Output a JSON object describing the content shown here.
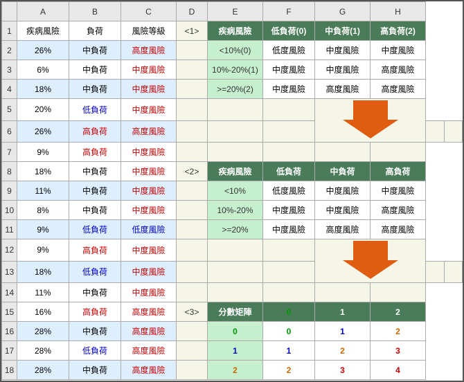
{
  "cols": {
    "rowHeader": "",
    "a": "A",
    "b": "B",
    "c": "C",
    "d": "D",
    "e": "E",
    "f": "F",
    "g": "G",
    "h": "H"
  },
  "rows": [
    {
      "rh": "1",
      "a": "疾病風險",
      "aClass": "",
      "b": "負荷",
      "bClass": "",
      "c": "風險等級",
      "cClass": "",
      "d": "<1>",
      "dClass": "d-label",
      "e": "疾病風險",
      "eClass": "tbl-header-dark",
      "f": "低負荷(0)",
      "fClass": "tbl-header-dark",
      "g": "中負荷(1)",
      "gClass": "tbl-header-dark",
      "h": "高負荷(2)",
      "hClass": "tbl-header-dark"
    },
    {
      "rh": "2",
      "a": "26%",
      "aClass": "",
      "b": "中負荷",
      "bClass": "",
      "c": "高度風險",
      "cClass": "red",
      "d": "",
      "dClass": "empty",
      "e": "<10%(0)",
      "eClass": "tbl-header-green",
      "f": "低度風險",
      "fClass": "bg-white",
      "g": "中度風險",
      "gClass": "bg-white",
      "h": "中度風險",
      "hClass": "bg-white"
    },
    {
      "rh": "3",
      "a": "6%",
      "aClass": "",
      "b": "中負荷",
      "bClass": "",
      "c": "中度風險",
      "cClass": "red",
      "d": "",
      "dClass": "empty",
      "e": "10%-20%(1)",
      "eClass": "tbl-header-green",
      "f": "中度風險",
      "fClass": "bg-white",
      "g": "中度風險",
      "gClass": "bg-white",
      "h": "高度風險",
      "hClass": "bg-white"
    },
    {
      "rh": "4",
      "a": "18%",
      "aClass": "",
      "b": "中負荷",
      "bClass": "",
      "c": "中度風險",
      "cClass": "red",
      "d": "",
      "dClass": "empty",
      "e": ">=20%(2)",
      "eClass": "tbl-header-green",
      "f": "中度風險",
      "fClass": "bg-white",
      "g": "高度風險",
      "gClass": "bg-white",
      "h": "高度風險",
      "hClass": "bg-white"
    },
    {
      "rh": "5",
      "a": "20%",
      "aClass": "",
      "b": "低負荷",
      "bClass": "blue",
      "c": "中度風險",
      "cClass": "red",
      "d": "",
      "dClass": "empty",
      "e": "",
      "eClass": "empty arrow-row",
      "f": "",
      "fClass": "empty arrow-row",
      "g": "arrow1",
      "gClass": "empty arrow-row",
      "h": "",
      "hClass": "empty arrow-row"
    },
    {
      "rh": "6",
      "a": "26%",
      "aClass": "",
      "b": "高負荷",
      "bClass": "red",
      "c": "高度風險",
      "cClass": "red",
      "d": "",
      "dClass": "empty",
      "e": "",
      "eClass": "empty",
      "f": "",
      "fClass": "empty",
      "g": "",
      "gClass": "empty",
      "h": "",
      "hClass": "empty"
    },
    {
      "rh": "7",
      "a": "9%",
      "aClass": "",
      "b": "高負荷",
      "bClass": "red",
      "c": "中度風險",
      "cClass": "red",
      "d": "",
      "dClass": "empty",
      "e": "",
      "eClass": "empty",
      "f": "",
      "fClass": "empty",
      "g": "",
      "gClass": "empty",
      "h": "",
      "hClass": "empty"
    },
    {
      "rh": "8",
      "a": "18%",
      "aClass": "",
      "b": "中負荷",
      "bClass": "",
      "c": "中度風險",
      "cClass": "red",
      "d": "<2>",
      "dClass": "d-label",
      "e": "疾病風險",
      "eClass": "tbl-header-dark",
      "f": "低負荷",
      "fClass": "tbl-header-dark",
      "g": "中負荷",
      "gClass": "tbl-header-dark",
      "h": "高負荷",
      "hClass": "tbl-header-dark"
    },
    {
      "rh": "9",
      "a": "11%",
      "aClass": "",
      "b": "中負荷",
      "bClass": "",
      "c": "中度風險",
      "cClass": "red",
      "d": "",
      "dClass": "empty",
      "e": "<10%",
      "eClass": "tbl-header-green",
      "f": "低度風險",
      "fClass": "bg-white",
      "g": "中度風險",
      "gClass": "bg-white",
      "h": "中度風險",
      "hClass": "bg-white"
    },
    {
      "rh": "10",
      "a": "8%",
      "aClass": "",
      "b": "中負荷",
      "bClass": "",
      "c": "中度風險",
      "cClass": "red",
      "d": "",
      "dClass": "empty",
      "e": "10%-20%",
      "eClass": "tbl-header-green",
      "f": "中度風險",
      "fClass": "bg-white",
      "g": "中度風險",
      "gClass": "bg-white",
      "h": "高度風險",
      "hClass": "bg-white"
    },
    {
      "rh": "11",
      "a": "9%",
      "aClass": "",
      "b": "低負荷",
      "bClass": "blue",
      "c": "低度風險",
      "cClass": "blue",
      "d": "",
      "dClass": "empty",
      "e": ">=20%",
      "eClass": "tbl-header-green",
      "f": "中度風險",
      "fClass": "bg-white",
      "g": "高度風險",
      "gClass": "bg-white",
      "h": "高度風險",
      "hClass": "bg-white"
    },
    {
      "rh": "12",
      "a": "9%",
      "aClass": "",
      "b": "高負荷",
      "bClass": "red",
      "c": "中度風險",
      "cClass": "red",
      "d": "",
      "dClass": "empty",
      "e": "",
      "eClass": "empty arrow-row2",
      "f": "",
      "fClass": "empty arrow-row2",
      "g": "arrow2",
      "gClass": "empty arrow-row2",
      "h": "",
      "hClass": "empty arrow-row2"
    },
    {
      "rh": "13",
      "a": "18%",
      "aClass": "",
      "b": "低負荷",
      "bClass": "blue",
      "c": "中度風險",
      "cClass": "red",
      "d": "",
      "dClass": "empty",
      "e": "",
      "eClass": "empty",
      "f": "",
      "fClass": "empty",
      "g": "",
      "gClass": "empty",
      "h": "",
      "hClass": "empty"
    },
    {
      "rh": "14",
      "a": "11%",
      "aClass": "",
      "b": "中負荷",
      "bClass": "",
      "c": "中度風險",
      "cClass": "red",
      "d": "",
      "dClass": "empty",
      "e": "",
      "eClass": "empty",
      "f": "",
      "fClass": "empty",
      "g": "",
      "gClass": "empty",
      "h": "",
      "hClass": "empty"
    },
    {
      "rh": "15",
      "a": "16%",
      "aClass": "",
      "b": "高負荷",
      "bClass": "red",
      "c": "高度風險",
      "cClass": "red",
      "d": "<3>",
      "dClass": "d-label",
      "e": "分數矩陣",
      "eClass": "score-header",
      "f": "0",
      "fClass": "score-header score-0",
      "g": "1",
      "gClass": "score-header score-1",
      "h": "2",
      "hClass": "score-header score-2"
    },
    {
      "rh": "16",
      "a": "28%",
      "aClass": "",
      "b": "中負荷",
      "bClass": "",
      "c": "高度風險",
      "cClass": "red",
      "d": "",
      "dClass": "empty",
      "e": "0",
      "eClass": "tbl-header-green score-0",
      "f": "0",
      "fClass": "bg-white score-0",
      "g": "1",
      "gClass": "bg-white score-1",
      "h": "2",
      "hClass": "bg-white score-2"
    },
    {
      "rh": "17",
      "a": "28%",
      "aClass": "",
      "b": "低負荷",
      "bClass": "blue",
      "c": "高度風險",
      "cClass": "red",
      "d": "",
      "dClass": "empty",
      "e": "1",
      "eClass": "tbl-header-green score-1",
      "f": "1",
      "fClass": "bg-white score-1",
      "g": "2",
      "gClass": "bg-white score-2",
      "h": "3",
      "hClass": "bg-white score-3"
    },
    {
      "rh": "18",
      "a": "28%",
      "aClass": "",
      "b": "中負荷",
      "bClass": "",
      "c": "高度風險",
      "cClass": "red",
      "d": "",
      "dClass": "empty",
      "e": "2",
      "eClass": "tbl-header-green score-2",
      "f": "2",
      "fClass": "bg-white score-2",
      "g": "3",
      "gClass": "bg-white score-3",
      "h": "4",
      "hClass": "bg-white score-4"
    }
  ]
}
